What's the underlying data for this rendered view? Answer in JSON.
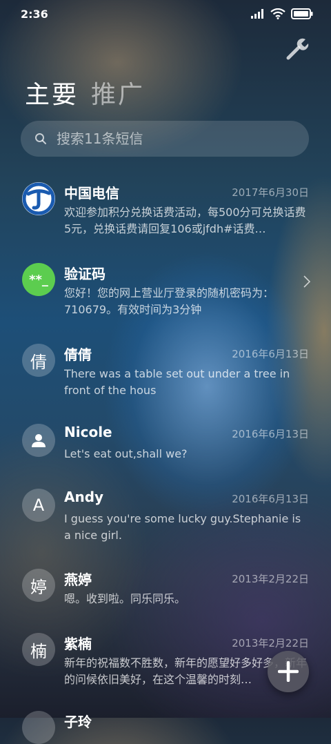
{
  "status": {
    "time": "2:36"
  },
  "tabs": {
    "primary": "主要",
    "secondary": "推广"
  },
  "search": {
    "placeholder": "搜索11条短信"
  },
  "conversations": [
    {
      "name": "中国电信",
      "date": "2017年6月30日",
      "preview": "欢迎参加积分兑换话费活动，每500分可兑换话费5元，兑换话费请回复106或jfdh#话费…",
      "avatar_icon": "china-telecom-logo-icon"
    },
    {
      "name": "验证码",
      "date": "",
      "preview": "您好！您的网上营业厅登录的随机密码为：710679。有效时间为3分钟",
      "avatar_text": "**_"
    },
    {
      "name": "倩倩",
      "date": "2016年6月13日",
      "preview": "There was a table set out under a tree in front of the hous",
      "avatar_text": "倩"
    },
    {
      "name": "Nicole",
      "date": "2016年6月13日",
      "preview": "Let's eat out,shall we?",
      "avatar_icon": "person-icon"
    },
    {
      "name": "Andy",
      "date": "2016年6月13日",
      "preview": "I guess you're some lucky guy.Stephanie is a nice girl.",
      "avatar_text": "A"
    },
    {
      "name": "燕婷",
      "date": "2013年2月22日",
      "preview": "嗯。收到啦。同乐同乐。",
      "avatar_text": "婷"
    },
    {
      "name": "紫楠",
      "date": "2013年2月22日",
      "preview": "新年的祝福数不胜数，新年的愿望好多好多，新年的问候依旧美好，在这个温馨的时刻…",
      "avatar_text": "楠"
    },
    {
      "name": "子玲",
      "date": "",
      "preview": "",
      "avatar_text": ""
    }
  ],
  "colors": {
    "verify_green": "#5ccd4f",
    "telecom_blue": "#1a5bb0"
  }
}
